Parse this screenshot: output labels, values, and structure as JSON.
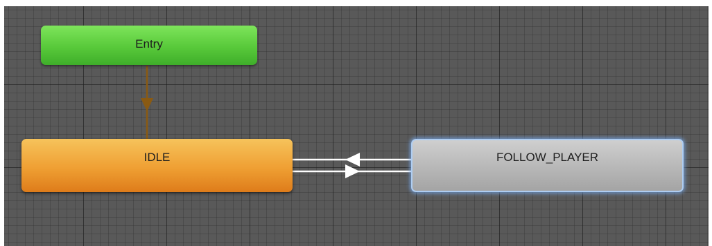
{
  "graph": {
    "states": {
      "entry": {
        "label": "Entry",
        "color": "#58c93a"
      },
      "idle": {
        "label": "IDLE",
        "color": "#ef9f33"
      },
      "follow_player": {
        "label": "FOLLOW_PLAYER",
        "color": "#b7b7b7",
        "selected": true
      }
    },
    "transitions": [
      {
        "from": "Entry",
        "to": "IDLE",
        "color": "#8a5a12"
      },
      {
        "from": "FOLLOW_PLAYER",
        "to": "IDLE",
        "color": "#ffffff"
      },
      {
        "from": "IDLE",
        "to": "FOLLOW_PLAYER",
        "color": "#ffffff"
      }
    ],
    "selection_color": "#aecdf2"
  }
}
